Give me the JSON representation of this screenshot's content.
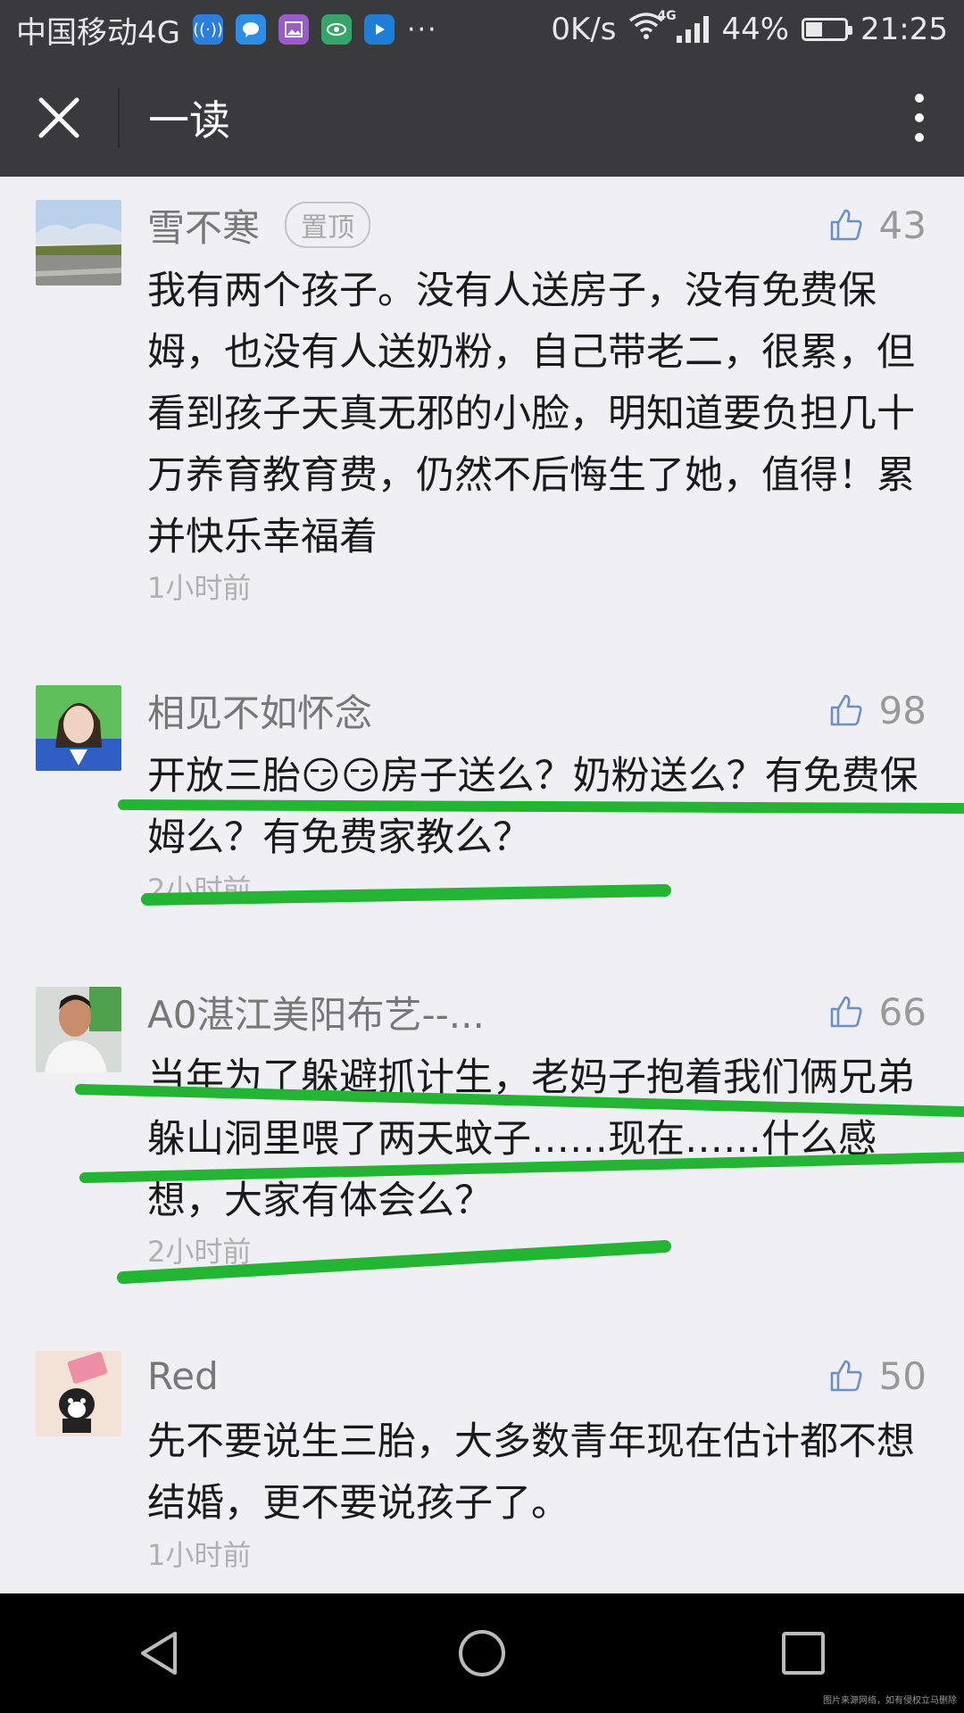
{
  "status_bar": {
    "carrier": "中国移动4G",
    "dots": "···",
    "net_speed": "0K/s",
    "network_tag": "4G",
    "battery_percent": "44%",
    "battery_level": 0.44,
    "time": "21:25"
  },
  "header": {
    "title": "一读"
  },
  "comments": [
    {
      "name": "雪不寒",
      "badge": "置顶",
      "likes": "43",
      "text": "我有两个孩子。没有人送房子，没有免费保姆，也没有人送奶粉，自己带老二，很累，但看到孩子天真无邪的小脸，明知道要负担几十万养育教育费，仍然不后悔生了她，值得！累并快乐幸福着",
      "time": "1小时前"
    },
    {
      "name": "相见不如怀念",
      "likes": "98",
      "text": "开放三胎😏😏房子送么？奶粉送么？有免费保姆么？有免费家教么？",
      "time": "2小时前"
    },
    {
      "name": "A0湛江美阳布艺--...",
      "likes": "66",
      "text": "当年为了躲避抓计生，老妈子抱着我们俩兄弟躲山洞里喂了两天蚊子……现在……什么感想，大家有体会么？",
      "time": "2小时前"
    },
    {
      "name": "Red",
      "likes": "50",
      "text": "先不要说生三胎，大多数青年现在估计都不想结婚，更不要说孩子了。",
      "time": "1小时前"
    }
  ],
  "watermark": "图片来源网络，如有侵权立马删除",
  "colors": {
    "bar_bg": "#3a3a3c",
    "page_bg": "#efeff4",
    "highlight_stroke": "#21b532"
  }
}
